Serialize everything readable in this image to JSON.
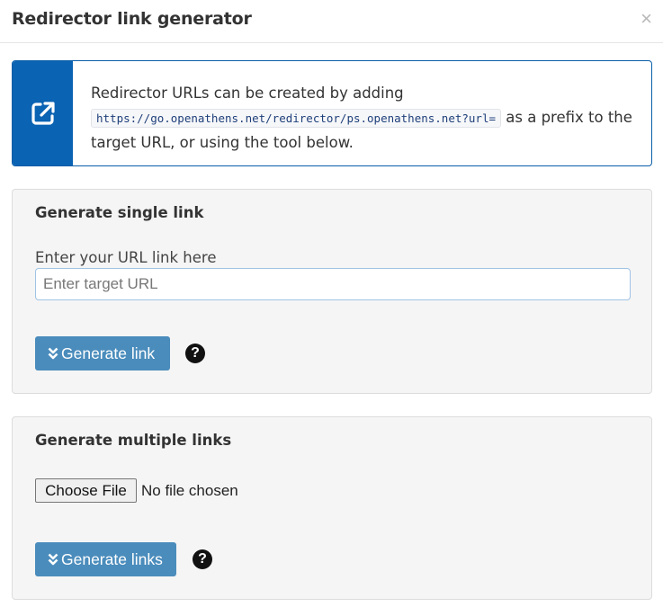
{
  "dialog": {
    "title": "Redirector link generator",
    "close_symbol": "×"
  },
  "info": {
    "icon": "external-link-icon",
    "text_before": "Redirector URLs can be created by adding",
    "code": "https://go.openathens.net/redirector/ps.openathens.net?url=",
    "text_after": "as a prefix to the target URL, or using the tool below."
  },
  "single": {
    "heading": "Generate single link",
    "label": "Enter your URL link here",
    "input_value": "",
    "placeholder": "Enter target URL",
    "button_label": "Generate link",
    "help_symbol": "?"
  },
  "multiple": {
    "heading": "Generate multiple links",
    "file_button": "Choose File",
    "file_status": "No file chosen",
    "button_label": "Generate links",
    "help_symbol": "?"
  },
  "colors": {
    "accent": "#0b63b3",
    "button": "#4a8cbc",
    "panel_bg": "#f5f5f5"
  }
}
